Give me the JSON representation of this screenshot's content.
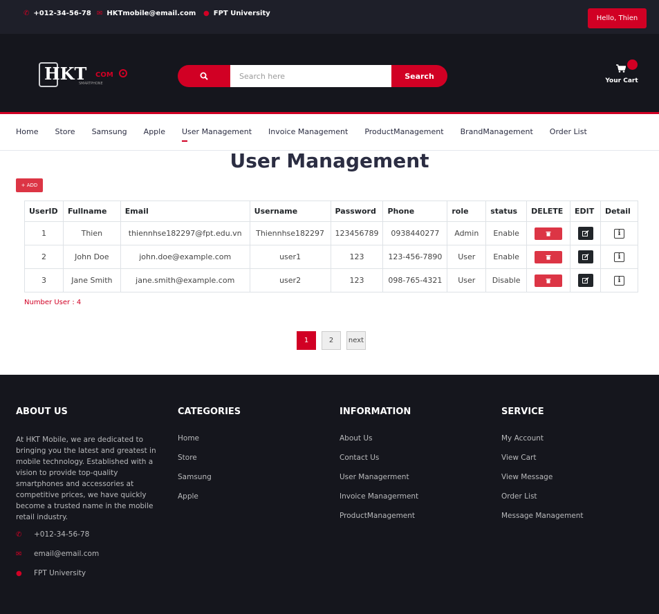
{
  "topbar": {
    "phone": "+012-34-56-78",
    "email": "HKTmobile@email.com",
    "location": "FPT University",
    "hello": "Hello, Thien"
  },
  "header": {
    "logo_main": "HKT",
    "logo_com": "COM",
    "logo_sub": "SMARTPHONE",
    "search_placeholder": "Search here",
    "search_button": "Search",
    "cart_label": "Your Cart"
  },
  "nav": {
    "items": [
      "Home",
      "Store",
      "Samsung",
      "Apple",
      "User Management",
      "Invoice Management",
      "ProductManagement",
      "BrandManagement",
      "Order List"
    ],
    "active": "User Management"
  },
  "main": {
    "title": "User Management",
    "add_label": "+ ADD",
    "columns": [
      "UserID",
      "Fullname",
      "Email",
      "Username",
      "Password",
      "Phone",
      "role",
      "status",
      "DELETE",
      "EDIT",
      "Detail"
    ],
    "rows": [
      {
        "id": "1",
        "fullname": "Thien",
        "email": "thiennhse182297@fpt.edu.vn",
        "username": "Thiennhse182297",
        "password": "123456789",
        "phone": "0938440277",
        "role": "Admin",
        "status": "Enable"
      },
      {
        "id": "2",
        "fullname": "John Doe",
        "email": "john.doe@example.com",
        "username": "user1",
        "password": "123",
        "phone": "123-456-7890",
        "role": "User",
        "status": "Enable"
      },
      {
        "id": "3",
        "fullname": "Jane Smith",
        "email": "jane.smith@example.com",
        "username": "user2",
        "password": "123",
        "phone": "098-765-4321",
        "role": "User",
        "status": "Disable"
      }
    ],
    "count_text": "Number User : 4",
    "pagination": {
      "pages": [
        "1",
        "2"
      ],
      "current": "1",
      "next": "next"
    }
  },
  "footer": {
    "about": {
      "title": "ABOUT US",
      "text": "At HKT Mobile, we are dedicated to bringing you the latest and greatest in mobile technology. Established with a vision to provide top-quality smartphones and accessories at competitive prices, we have quickly become a trusted name in the mobile retail industry.",
      "phone": "+012-34-56-78",
      "email": "email@email.com",
      "location": "FPT University"
    },
    "categories": {
      "title": "CATEGORIES",
      "items": [
        "Home",
        "Store",
        "Samsung",
        "Apple"
      ]
    },
    "information": {
      "title": "INFORMATION",
      "items": [
        "About Us",
        "Contact Us",
        "User Managerment",
        "Invoice Managerment",
        "ProductManagement"
      ]
    },
    "service": {
      "title": "SERVICE",
      "items": [
        "My Account",
        "View Cart",
        "View Message",
        "Order List",
        "Message Management"
      ]
    }
  },
  "icons": {
    "phone": "phone-icon",
    "email": "envelope-icon",
    "location": "map-marker-icon",
    "search": "search-icon",
    "cart": "cart-icon",
    "delete": "trash-icon",
    "edit": "edit-icon",
    "detail": "info-icon"
  },
  "colors": {
    "accent": "#d10024",
    "dark": "#15161d",
    "topbar": "#1e1f29",
    "danger": "#dc3545"
  }
}
